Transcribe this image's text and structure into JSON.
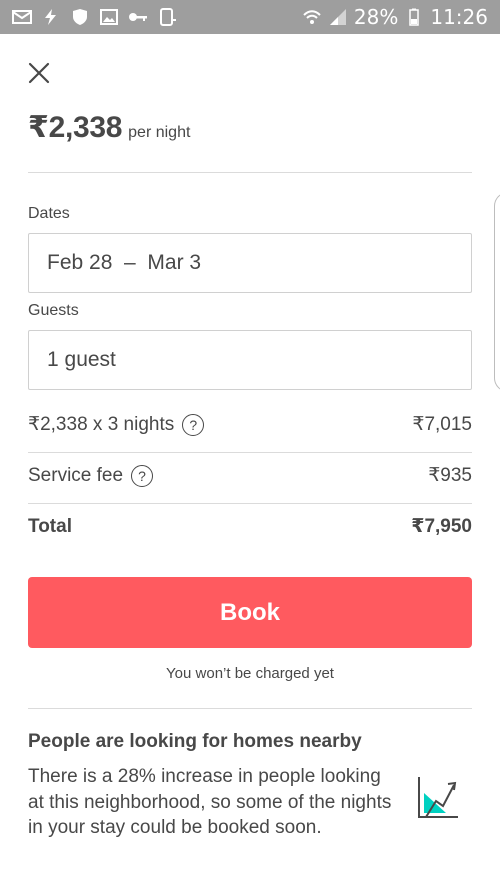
{
  "status_bar": {
    "battery": "28%",
    "time": "11:26",
    "icons": [
      "mail-icon",
      "bolt-icon",
      "shield-icon",
      "image-icon",
      "key-icon",
      "phone-icon",
      "wifi-icon",
      "signal-icon",
      "battery-icon"
    ]
  },
  "listing": {
    "price": "₹2,338",
    "per_night": "per night"
  },
  "dates": {
    "label": "Dates",
    "value": "Feb 28  –  Mar 3"
  },
  "guests": {
    "label": "Guests",
    "value": "1 guest"
  },
  "breakdown": {
    "nights_label": "₹2,338 x 3 nights",
    "nights_amount": "₹7,015",
    "service_label": "Service fee",
    "service_amount": "₹935",
    "total_label": "Total",
    "total_amount": "₹7,950",
    "help_glyph": "?"
  },
  "book": {
    "label": "Book",
    "note": "You won’t be charged yet"
  },
  "promo": {
    "title": "People are looking for homes nearby",
    "body": "There is a 28% increase in people looking at this neighborhood, so some of the nights in your stay could be booked soon."
  },
  "colors": {
    "accent": "#ff5a5f",
    "text": "#484848",
    "status_bar": "#9e9e9e",
    "trend_teal": "#00d1c1"
  }
}
